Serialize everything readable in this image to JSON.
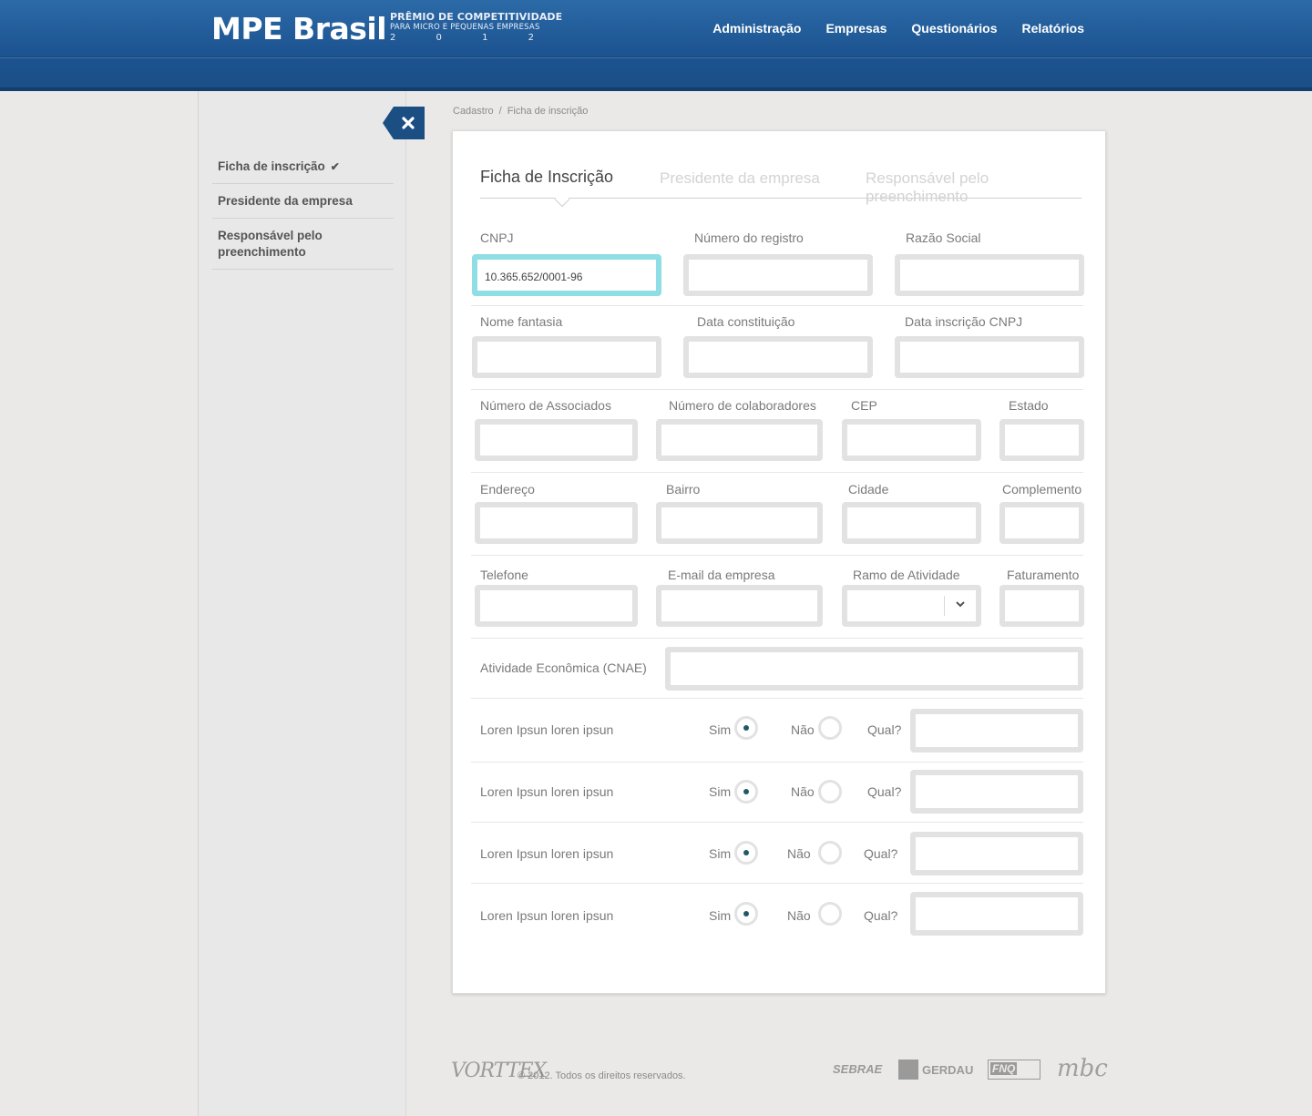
{
  "header": {
    "logo": "MPE Brasil",
    "award_line1": "PRÊMIO DE COMPETITIVIDADE",
    "award_line2": "PARA MICRO E PEQUENAS EMPRESAS",
    "award_year": [
      "2",
      "0",
      "1",
      "2"
    ],
    "nav": [
      "Administração",
      "Empresas",
      "Questionários",
      "Relatórios"
    ]
  },
  "sidebar": {
    "items": [
      {
        "label": "Ficha de inscrição",
        "checked": true
      },
      {
        "label": "Presidente da empresa"
      },
      {
        "label": "Responsável pelo preenchimento"
      }
    ],
    "close_icon": "close-icon"
  },
  "breadcrumb": {
    "root": "Cadastro",
    "separator": "/",
    "current": "Ficha de inscrição"
  },
  "tabs": [
    "Ficha de Inscrição",
    "Presidente da empresa",
    "Responsável pelo preenchimento"
  ],
  "form": {
    "cnpj": {
      "label": "CNPJ",
      "value": "10.365.652/0001-96"
    },
    "numero_registro": {
      "label": "Número do registro",
      "value": ""
    },
    "razao_social": {
      "label": "Razão Social",
      "value": ""
    },
    "nome_fantasia": {
      "label": "Nome fantasia",
      "value": ""
    },
    "data_constituicao": {
      "label": "Data constituição",
      "value": ""
    },
    "data_inscricao": {
      "label": "Data inscrição CNPJ",
      "value": ""
    },
    "num_associados": {
      "label": "Número  de Associados",
      "value": ""
    },
    "num_colaboradores": {
      "label": "Número de colaboradores",
      "value": ""
    },
    "cep": {
      "label": "CEP",
      "value": ""
    },
    "estado": {
      "label": "Estado",
      "value": ""
    },
    "endereco": {
      "label": "Endereço",
      "value": ""
    },
    "bairro": {
      "label": "Bairro",
      "value": ""
    },
    "cidade": {
      "label": "Cidade",
      "value": ""
    },
    "complemento": {
      "label": "Complemento",
      "value": ""
    },
    "telefone": {
      "label": "Telefone",
      "value": ""
    },
    "email": {
      "label": "E-mail da empresa",
      "value": ""
    },
    "ramo": {
      "label": "Ramo de Atividade",
      "value": ""
    },
    "faturamento": {
      "label": "Faturamento",
      "value": ""
    },
    "cnae": {
      "label": "Atividade Econômica (CNAE)",
      "value": ""
    },
    "questions": [
      {
        "label": "Loren Ipsun loren ipsun",
        "yes": "Sim",
        "no": "Não",
        "which": "Qual?",
        "selected": "Sim"
      },
      {
        "label": "Loren Ipsun loren ipsun",
        "yes": "Sim",
        "no": "Não",
        "which": "Qual?",
        "selected": "Sim"
      },
      {
        "label": "Loren Ipsun loren ipsun",
        "yes": "Sim",
        "no": "Não",
        "which": "Qual?",
        "selected": "Sim"
      },
      {
        "label": "Loren Ipsun loren ipsun",
        "yes": "Sim",
        "no": "Não",
        "which": "Qual?",
        "selected": "Sim"
      }
    ]
  },
  "footer": {
    "brand": "VORTTEX",
    "copyright": "© 2012. Todos os direitos reservados.",
    "partners": [
      "SEBRAE",
      "GERDAU",
      "FNQ",
      "mbc"
    ]
  },
  "colors": {
    "header": "#1d5592",
    "focus_border": "#8fdde5",
    "radio_dot": "#1e5a66"
  }
}
